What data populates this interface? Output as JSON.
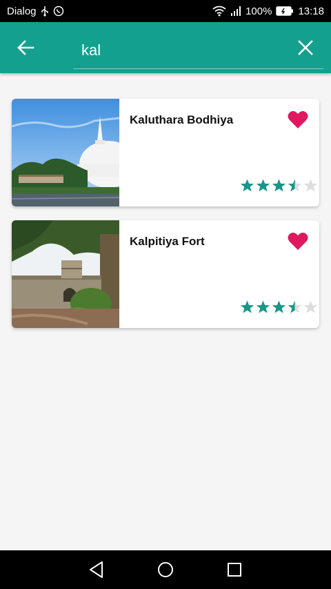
{
  "status_bar": {
    "app_label": "Dialog",
    "battery": "100%",
    "time": "13:18"
  },
  "search": {
    "query": "kal"
  },
  "colors": {
    "primary": "#14a08f",
    "favorite": "#e0185f",
    "star_filled": "#17968a",
    "star_empty": "#dddddd"
  },
  "results": [
    {
      "title": "Kaluthara Bodhiya",
      "rating": 3.5,
      "favorite": true,
      "image_icon": "stupa-photo"
    },
    {
      "title": "Kalpitiya Fort",
      "rating": 3.5,
      "favorite": true,
      "image_icon": "fort-photo"
    }
  ],
  "icons": {
    "back": "arrow-left-icon",
    "clear": "close-icon",
    "favorite": "heart-icon",
    "nav_back": "triangle-back-icon",
    "nav_home": "circle-home-icon",
    "nav_recents": "square-recents-icon"
  }
}
